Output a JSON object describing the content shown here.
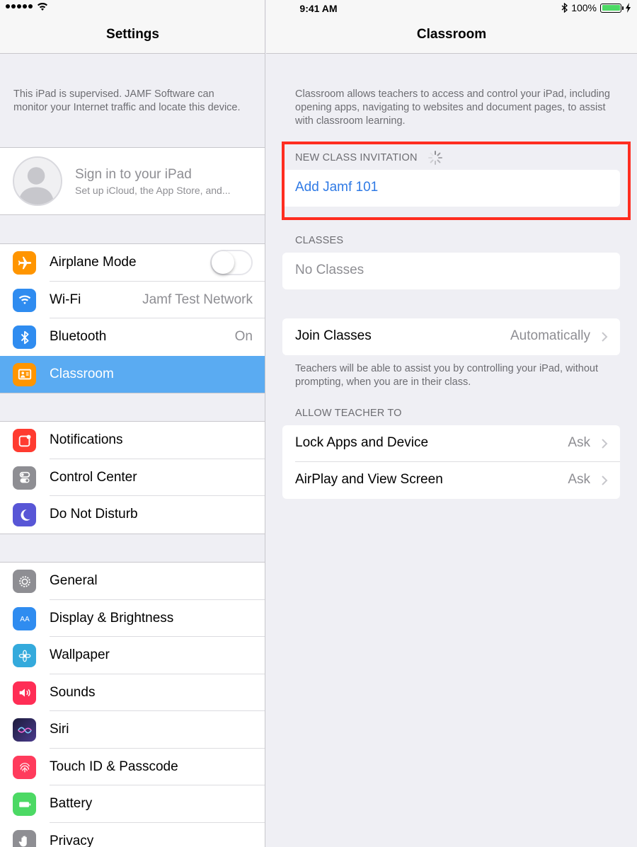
{
  "status_bar": {
    "time": "9:41 AM",
    "battery_percent": "100%",
    "battery_level": 1.0,
    "signal_bars": 5
  },
  "settings_pane": {
    "title": "Settings",
    "supervised_notice": "This iPad is supervised. JAMF Software can monitor your Internet traffic and locate this device.",
    "profile": {
      "title": "Sign in to your iPad",
      "subtitle": "Set up iCloud, the App Store, and..."
    },
    "group1": [
      {
        "label": "Airplane Mode",
        "icon": "airplane-icon",
        "color": "#ff9500",
        "toggle": false
      },
      {
        "label": "Wi-Fi",
        "icon": "wifi-icon",
        "color": "#2f8cf0",
        "value": "Jamf Test Network"
      },
      {
        "label": "Bluetooth",
        "icon": "bluetooth-icon",
        "color": "#2f8cf0",
        "value": "On"
      },
      {
        "label": "Classroom",
        "icon": "classroom-icon",
        "color": "#ff9500",
        "selected": true
      }
    ],
    "group2": [
      {
        "label": "Notifications",
        "icon": "notifications-icon",
        "color": "#ff3b30"
      },
      {
        "label": "Control Center",
        "icon": "control-center-icon",
        "color": "#8e8e93"
      },
      {
        "label": "Do Not Disturb",
        "icon": "moon-icon",
        "color": "#5856d6"
      }
    ],
    "group3": [
      {
        "label": "General",
        "icon": "gear-icon",
        "color": "#8e8e93"
      },
      {
        "label": "Display & Brightness",
        "icon": "display-icon",
        "color": "#2f8cf0"
      },
      {
        "label": "Wallpaper",
        "icon": "wallpaper-icon",
        "color": "#34aadc"
      },
      {
        "label": "Sounds",
        "icon": "speaker-icon",
        "color": "#ff2d55"
      },
      {
        "label": "Siri",
        "icon": "siri-icon",
        "color": "#1c1c3c"
      },
      {
        "label": "Touch ID & Passcode",
        "icon": "fingerprint-icon",
        "color": "#ff3b5c"
      },
      {
        "label": "Battery",
        "icon": "battery-icon",
        "color": "#4cd964"
      },
      {
        "label": "Privacy",
        "icon": "hand-icon",
        "color": "#8e8e93"
      }
    ]
  },
  "classroom_pane": {
    "title": "Classroom",
    "description": "Classroom allows teachers to access and control your iPad, including opening apps, navigating to websites and document pages, to assist with classroom learning.",
    "new_class_header": "NEW CLASS INVITATION",
    "new_class_action": "Add Jamf 101",
    "classes_header": "CLASSES",
    "classes_empty": "No Classes",
    "join_classes": {
      "label": "Join Classes",
      "value": "Automatically"
    },
    "join_footer": "Teachers will be able to assist you by controlling your iPad, without prompting, when you are in their class.",
    "allow_header": "ALLOW TEACHER TO",
    "allow_rows": [
      {
        "label": "Lock Apps and Device",
        "value": "Ask"
      },
      {
        "label": "AirPlay and View Screen",
        "value": "Ask"
      }
    ],
    "highlight_color": "#ff2d20"
  }
}
